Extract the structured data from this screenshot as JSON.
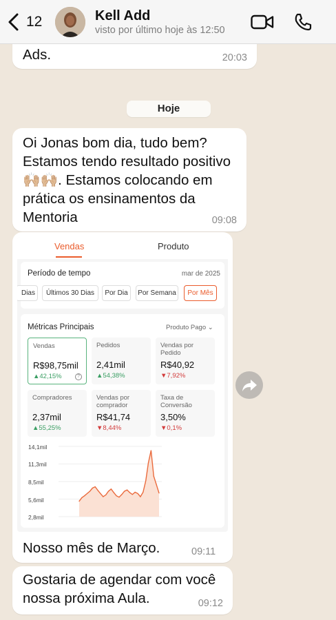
{
  "header": {
    "back_count": "12",
    "contact_name": "Kell Add",
    "status": "visto por último hoje às 12:50",
    "icons": [
      "back-chevron-icon",
      "video-call-icon",
      "phone-icon"
    ]
  },
  "messages": [
    {
      "text_tail": "Ads.",
      "time": "20:03"
    },
    {
      "date_chip": "Hoje"
    },
    {
      "text_1": "Oi Jonas bom dia, tudo bem?",
      "text_2": "Estamos tendo resultado positivo",
      "text_3": ". Estamos colocando em",
      "emoji": "🙌🏼🙌🏼",
      "text_4": "prática os ensinamentos da",
      "text_5": "Mentoria",
      "time": "09:08"
    },
    {
      "caption": "Nosso mês de Março.",
      "time": "09:11"
    },
    {
      "text_1": "Gostaria de agendar com você",
      "text_2": "nossa próxima Aula.",
      "time": "09:12"
    }
  ],
  "screenshot": {
    "tabs": [
      "Vendas",
      "Produto"
    ],
    "period_title": "Período de tempo",
    "period_date": "mar de 2025",
    "period_options": [
      "Dias",
      "Últimos 30 Dias",
      "Por Dia",
      "Por Semana",
      "Por Mês"
    ],
    "metrics_title": "Métricas Principais",
    "metrics_filter": "Produto Pago",
    "metrics": [
      {
        "label": "Vendas",
        "value": "R$98,75mil",
        "delta": "▲42,15%",
        "dir": "up"
      },
      {
        "label": "Pedidos",
        "value": "2,41mil",
        "delta": "▲54,38%",
        "dir": "up"
      },
      {
        "label": "Vendas por Pedido",
        "value": "R$40,92",
        "delta": "▼7,92%",
        "dir": "down"
      },
      {
        "label": "Compradores",
        "value": "2,37mil",
        "delta": "▲55,25%",
        "dir": "up"
      },
      {
        "label": "Vendas por comprador",
        "value": "R$41,74",
        "delta": "▼8,44%",
        "dir": "down"
      },
      {
        "label": "Taxa de Conversão",
        "value": "3,50%",
        "delta": "▼0,1%",
        "dir": "down"
      }
    ],
    "chart_data": {
      "type": "area",
      "yticks": [
        "14,1mil",
        "11,3mil",
        "8,5mil",
        "5,6mil",
        "2,8mil"
      ],
      "ylim": [
        0,
        15.5
      ],
      "x": [
        1,
        2,
        3,
        4,
        5,
        6,
        7,
        8,
        9,
        10,
        11,
        12,
        13,
        14,
        15,
        16,
        17,
        18,
        19,
        20,
        21,
        22,
        23,
        24,
        25,
        26,
        27,
        28,
        29,
        30,
        31
      ],
      "values": [
        3.4,
        4.2,
        4.6,
        5.1,
        5.6,
        6.3,
        6.6,
        5.8,
        5.1,
        4.4,
        4.8,
        5.6,
        6.1,
        5.3,
        4.6,
        4.3,
        4.9,
        5.6,
        5.9,
        5.3,
        4.9,
        5.4,
        5.1,
        4.4,
        5.4,
        7.9,
        11.9,
        14.6,
        8.9,
        7.1,
        5.2
      ],
      "color": "#ea6a3c"
    }
  },
  "colors": {
    "accent": "#ea5b2b",
    "up": "#3a9e63",
    "down": "#d23b3b"
  }
}
